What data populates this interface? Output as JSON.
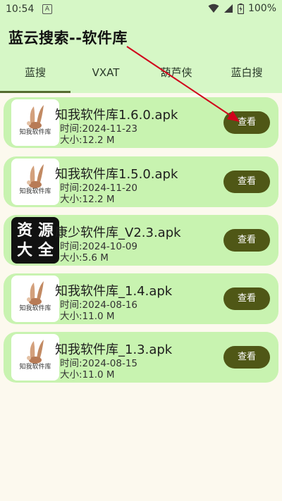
{
  "status_bar": {
    "time": "10:54",
    "notification_letter": "A",
    "battery": "100%"
  },
  "header": {
    "title": "蓝云搜索--软件库"
  },
  "tabs": [
    {
      "label": "蓝搜",
      "active": true
    },
    {
      "label": "VXAT",
      "active": false
    },
    {
      "label": "葫芦侠",
      "active": false
    },
    {
      "label": "蓝白搜",
      "active": false
    }
  ],
  "items": [
    {
      "name": "知我软件库1.6.0.apk",
      "date": "时间:2024-11-23",
      "size": "大小:12.2 M",
      "button": "查看",
      "thumb_caption": "知我软件库"
    },
    {
      "name": "知我软件库1.5.0.apk",
      "date": "时间:2024-11-20",
      "size": "大小:12.2 M",
      "button": "查看",
      "thumb_caption": "知我软件库"
    },
    {
      "name": "康少软件库_V2.3.apk",
      "date": "时间:2024-10-09",
      "size": "大小:5.6 M",
      "button": "查看",
      "thumb_line1": "资 源",
      "thumb_line2": "大 全"
    },
    {
      "name": "知我软件库_1.4.apk",
      "date": "时间:2024-08-16",
      "size": "大小:11.0 M",
      "button": "查看",
      "thumb_caption": "知我软件库"
    },
    {
      "name": "知我软件库_1.3.apk",
      "date": "时间:2024-08-15",
      "size": "大小:11.0 M",
      "button": "查看",
      "thumb_caption": "知我软件库"
    }
  ],
  "colors": {
    "header_bg": "#d6f7c6",
    "card_bg": "#c8f3b0",
    "button_bg": "#4f5716",
    "page_bg": "#fcf9ee",
    "annotation_arrow": "#d0021b"
  }
}
